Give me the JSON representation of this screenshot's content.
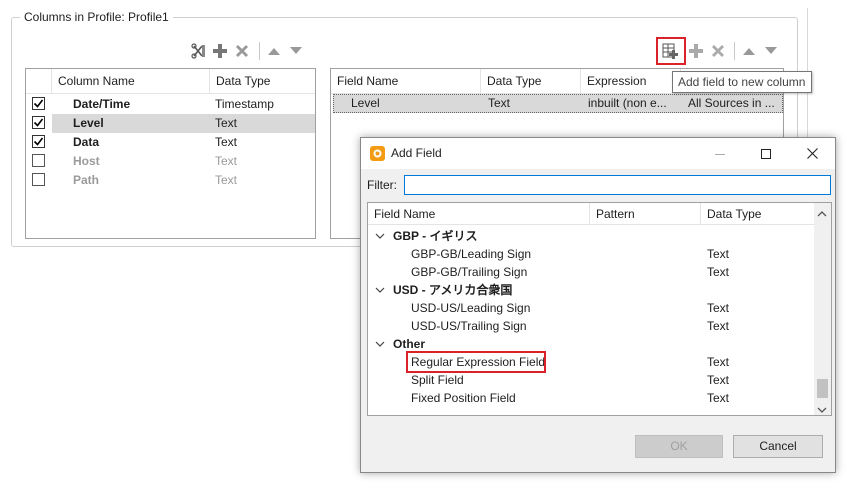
{
  "group": {
    "title": "Columns in Profile: Profile1"
  },
  "left_grid": {
    "headers": [
      "Column Name",
      "Data Type"
    ],
    "rows": [
      {
        "name": "Date/Time",
        "type": "Timestamp",
        "checked": true,
        "bold": true,
        "selected": false
      },
      {
        "name": "Level",
        "type": "Text",
        "checked": true,
        "bold": true,
        "selected": true
      },
      {
        "name": "Data",
        "type": "Text",
        "checked": true,
        "bold": true,
        "selected": false
      },
      {
        "name": "Host",
        "type": "Text",
        "checked": false,
        "bold": true,
        "selected": false
      },
      {
        "name": "Path",
        "type": "Text",
        "checked": false,
        "bold": true,
        "selected": false
      }
    ]
  },
  "right_grid": {
    "headers": [
      "Field Name",
      "Data Type",
      "Expression",
      ""
    ],
    "row": {
      "field": "Level",
      "type": "Text",
      "expression": "inbuilt (non e...",
      "sources": "All Sources in ..."
    }
  },
  "tooltip": {
    "text": "Add field to new column"
  },
  "dialog": {
    "title": "Add Field",
    "filter_label": "Filter:",
    "filter_value": "",
    "tree_headers": [
      "Field Name",
      "Pattern",
      "Data Type"
    ],
    "groups": [
      {
        "name": "GBP - イギリス",
        "items": [
          {
            "name": "GBP-GB/Leading Sign",
            "type": "Text"
          },
          {
            "name": "GBP-GB/Trailing Sign",
            "type": "Text"
          }
        ]
      },
      {
        "name": "USD - アメリカ合衆国",
        "items": [
          {
            "name": "USD-US/Leading Sign",
            "type": "Text"
          },
          {
            "name": "USD-US/Trailing Sign",
            "type": "Text"
          }
        ]
      },
      {
        "name": "Other",
        "items": [
          {
            "name": "Regular Expression Field",
            "type": "Text"
          },
          {
            "name": "Split Field",
            "type": "Text"
          },
          {
            "name": "Fixed Position Field",
            "type": "Text"
          }
        ]
      }
    ],
    "ok_label": "OK",
    "cancel_label": "Cancel"
  },
  "colors": {
    "accent": "#0078d7",
    "highlight": "#d9222a",
    "selection": "#d9d9d9",
    "icon_orange": "#f39c12"
  }
}
